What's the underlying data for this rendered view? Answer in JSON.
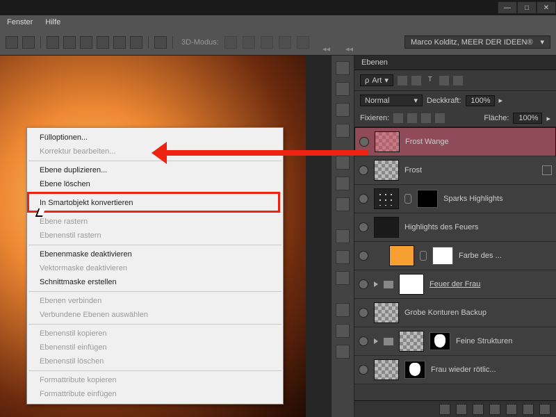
{
  "menubar": {
    "items": [
      "Fenster",
      "Hilfe"
    ]
  },
  "optionsbar": {
    "mode_label": "3D-Modus:",
    "user": "Marco Kolditz, MEER DER IDEEN®"
  },
  "context_menu": {
    "groups": [
      [
        {
          "label": "Fülloptionen...",
          "enabled": true
        },
        {
          "label": "Korrektur bearbeiten...",
          "enabled": false
        }
      ],
      [
        {
          "label": "Ebene duplizieren...",
          "enabled": true
        },
        {
          "label": "Ebene löschen",
          "enabled": true
        }
      ],
      [
        {
          "label": "In Smartobjekt konvertieren",
          "enabled": true,
          "highlight": true
        }
      ],
      [
        {
          "label": "Ebene rastern",
          "enabled": false
        },
        {
          "label": "Ebenenstil rastern",
          "enabled": false
        }
      ],
      [
        {
          "label": "Ebenenmaske deaktivieren",
          "enabled": true
        },
        {
          "label": "Vektormaske deaktivieren",
          "enabled": false
        },
        {
          "label": "Schnittmaske erstellen",
          "enabled": true
        }
      ],
      [
        {
          "label": "Ebenen verbinden",
          "enabled": false
        },
        {
          "label": "Verbundene Ebenen auswählen",
          "enabled": false
        }
      ],
      [
        {
          "label": "Ebenenstil kopieren",
          "enabled": false
        },
        {
          "label": "Ebenenstil einfügen",
          "enabled": false
        },
        {
          "label": "Ebenenstil löschen",
          "enabled": false
        }
      ],
      [
        {
          "label": "Formattribute kopieren",
          "enabled": false
        },
        {
          "label": "Formattribute einfügen",
          "enabled": false
        }
      ]
    ]
  },
  "layers_panel": {
    "title": "Ebenen",
    "filter": "Art",
    "blend_mode": "Normal",
    "opacity_label": "Deckkraft:",
    "opacity_value": "100%",
    "lock_label": "Fixieren:",
    "fill_label": "Fläche:",
    "fill_value": "100%",
    "layers": [
      {
        "name": "Frost Wange",
        "selected": true,
        "thumb": "red"
      },
      {
        "name": "Frost",
        "thumb": "checker",
        "extra": "box"
      },
      {
        "name": "Sparks Highlights",
        "thumb": "sparks",
        "link": true,
        "mask": "black"
      },
      {
        "name": "Highlights des Feuers",
        "thumb": "dark"
      },
      {
        "name": "Farbe des ...",
        "thumb": "orange",
        "indent": true,
        "link": true,
        "mask": "white"
      },
      {
        "name": "Feuer der Frau",
        "thumb": "white",
        "folder": true,
        "underline": true
      },
      {
        "name": "Grobe Konturen Backup",
        "thumb": "checker"
      },
      {
        "name": "Feine Strukturen",
        "folder": true,
        "mask": "sp"
      },
      {
        "name": "Frau wieder rötlic...",
        "mask": "sp"
      }
    ]
  }
}
